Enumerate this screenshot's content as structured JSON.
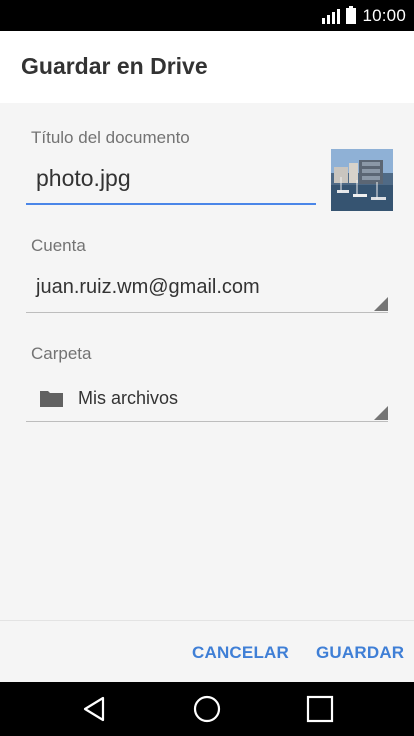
{
  "status": {
    "time": "10:00"
  },
  "header": {
    "title": "Guardar en Drive"
  },
  "form": {
    "title_label": "Título del documento",
    "title_value": "photo.jpg",
    "account_label": "Cuenta",
    "account_value": "juan.ruiz.wm@gmail.com",
    "folder_label": "Carpeta",
    "folder_value": "Mis archivos"
  },
  "actions": {
    "cancel": "CANCELAR",
    "save": "GUARDAR"
  },
  "icons": {
    "signal": "signal-icon",
    "battery": "battery-icon",
    "folder": "folder-icon",
    "back": "back-icon",
    "home": "home-icon",
    "recent": "recent-apps-icon"
  },
  "colors": {
    "accent": "#3f7fd6"
  }
}
